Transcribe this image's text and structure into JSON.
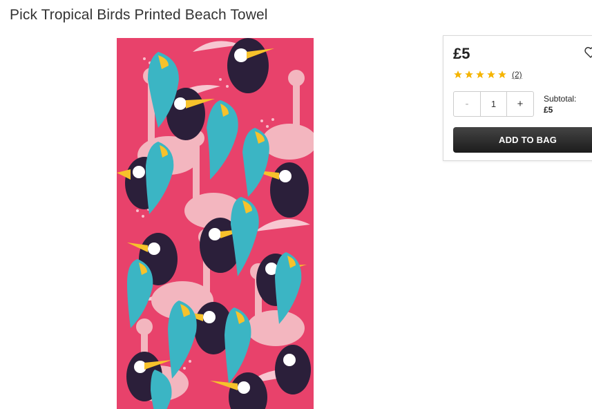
{
  "product": {
    "title": "Pick Tropical Birds Printed Beach Towel"
  },
  "image": {
    "alt": "Pink Tropical Birds Printed Beach Towel",
    "colors": {
      "background": "#e8426b",
      "flamingo": "#f3b6bf",
      "toucan": "#2b1f3a",
      "parrot": "#3bb5c4",
      "beak": "#f7c22b",
      "leaf": "#f7d4da"
    }
  },
  "buy_box": {
    "price": "£5",
    "rating": {
      "stars": 5,
      "reviews_text": "(2)",
      "star_color": "#f5b400"
    },
    "quantity": {
      "minus": "-",
      "value": "1",
      "plus": "+"
    },
    "subtotal": {
      "label": "Subtotal:",
      "value": "£5"
    },
    "add_to_bag_label": "ADD TO BAG",
    "wishlist_icon": "heart-icon"
  }
}
